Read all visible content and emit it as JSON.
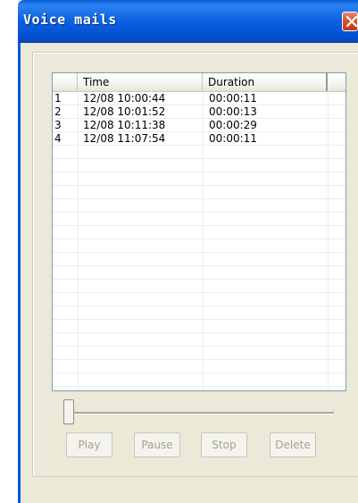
{
  "window": {
    "title": "Voice mails",
    "close_icon": "close-icon"
  },
  "list": {
    "columns": [
      "",
      "Time",
      "Duration"
    ],
    "rows": [
      {
        "index": "1",
        "time": "12/08 10:00:44",
        "duration": "00:00:11"
      },
      {
        "index": "2",
        "time": "12/08 10:01:52",
        "duration": "00:00:13"
      },
      {
        "index": "3",
        "time": "12/08 10:11:38",
        "duration": "00:00:29"
      },
      {
        "index": "4",
        "time": "12/08 11:07:54",
        "duration": "00:00:11"
      }
    ]
  },
  "playback": {
    "position_fraction": 0.0
  },
  "buttons": {
    "play": "Play",
    "pause": "Pause",
    "stop": "Stop",
    "delete": "Delete"
  }
}
